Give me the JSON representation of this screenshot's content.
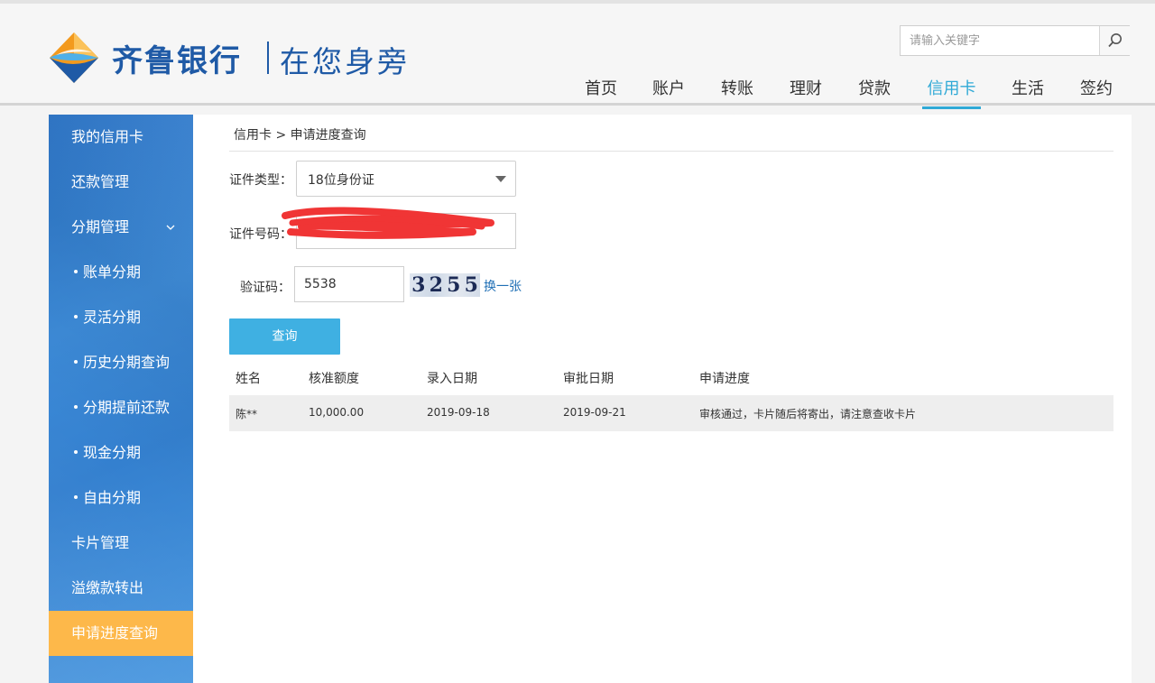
{
  "header": {
    "bank_name": "齐鲁银行",
    "slogan": "在您身旁",
    "logo_colors": {
      "blue": "#1f5aa6",
      "orange": "#f39a1e",
      "lightblue": "#4fb0e8"
    },
    "search": {
      "placeholder": "请输入关键字",
      "icon": "search-icon"
    },
    "nav": [
      {
        "label": "首页",
        "active": false
      },
      {
        "label": "账户",
        "active": false
      },
      {
        "label": "转账",
        "active": false
      },
      {
        "label": "理财",
        "active": false
      },
      {
        "label": "贷款",
        "active": false
      },
      {
        "label": "信用卡",
        "active": true
      },
      {
        "label": "生活",
        "active": false
      },
      {
        "label": "签约",
        "active": false
      }
    ],
    "accent_color": "#2fa9d6"
  },
  "sidebar": {
    "items": [
      {
        "label": "我的信用卡",
        "sub": false,
        "active": false
      },
      {
        "label": "还款管理",
        "sub": false,
        "active": false
      },
      {
        "label": "分期管理",
        "sub": false,
        "active": false,
        "expandable": true
      },
      {
        "label": "账单分期",
        "sub": true,
        "active": false
      },
      {
        "label": "灵活分期",
        "sub": true,
        "active": false
      },
      {
        "label": "历史分期查询",
        "sub": true,
        "active": false
      },
      {
        "label": "分期提前还款",
        "sub": true,
        "active": false
      },
      {
        "label": "现金分期",
        "sub": true,
        "active": false
      },
      {
        "label": "自由分期",
        "sub": true,
        "active": false
      },
      {
        "label": "卡片管理",
        "sub": false,
        "active": false
      },
      {
        "label": "溢缴款转出",
        "sub": false,
        "active": false
      },
      {
        "label": "申请进度查询",
        "sub": false,
        "active": true
      }
    ],
    "active_color": "#fdb84a",
    "expand_icon": "chevron-down-icon"
  },
  "main": {
    "breadcrumb": "信用卡 > 申请进度查询",
    "form": {
      "id_type_label": "证件类型：",
      "id_type_value": "18位身份证",
      "id_number_label": "证件号码：",
      "captcha_label": "验证码：",
      "captcha_value": "5538",
      "captcha_image_chars": [
        "3",
        "2",
        "5",
        "5"
      ],
      "captcha_refresh": "换一张",
      "query_button": "查询"
    },
    "table": {
      "columns": [
        "姓名",
        "核准额度",
        "录入日期",
        "审批日期",
        "申请进度"
      ],
      "rows": [
        [
          "陈**",
          "10,000.00",
          "2019-09-18",
          "2019-09-21",
          "审核通过，卡片随后将寄出，请注意查收卡片"
        ]
      ]
    },
    "button_color": "#3fb0e2"
  }
}
